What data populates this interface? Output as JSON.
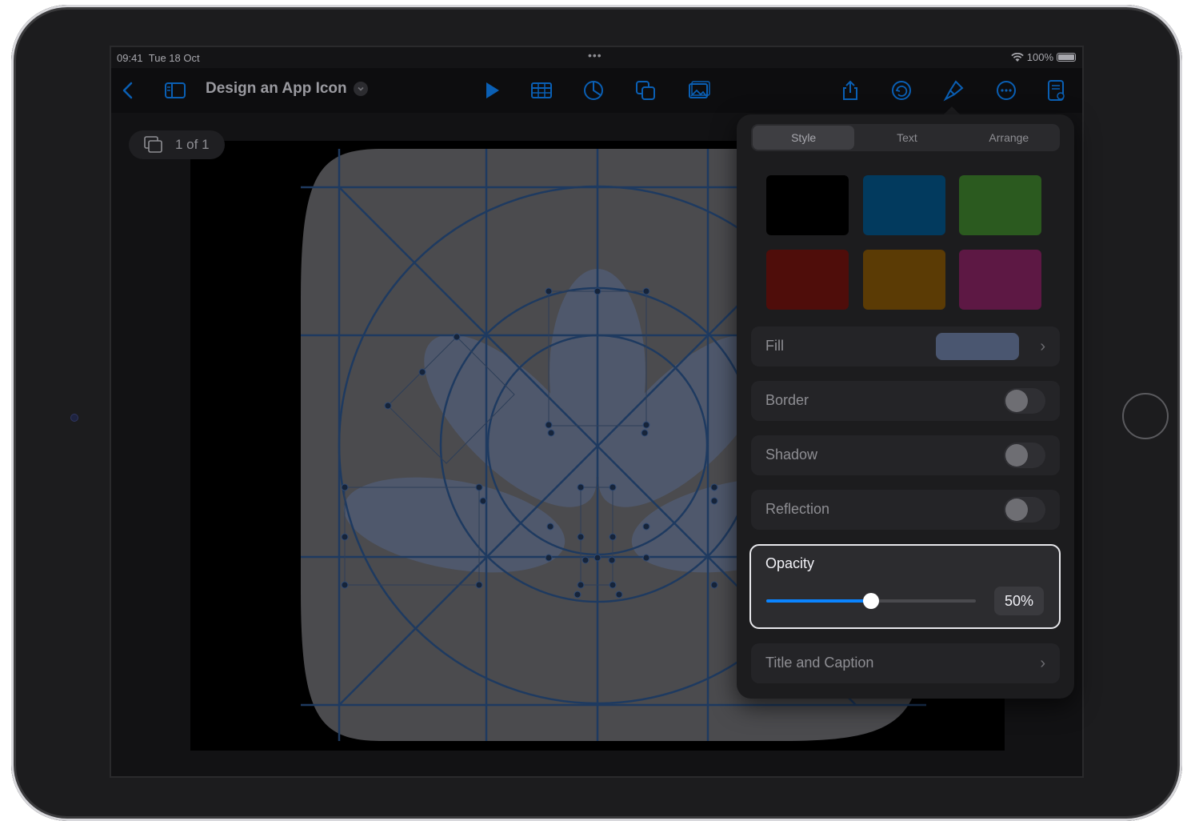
{
  "status_bar": {
    "time": "09:41",
    "date": "Tue 18 Oct",
    "dots": "•••",
    "battery": "100%"
  },
  "toolbar": {
    "title": "Design an App Icon",
    "icons": [
      "back-chevron-icon",
      "sidebar-icon",
      "play-icon",
      "table-icon",
      "chart-icon",
      "shapes-icon",
      "media-icon",
      "share-icon",
      "undo-icon",
      "format-brush-icon",
      "more-icon",
      "document-icon"
    ]
  },
  "canvas": {
    "page_indicator": "1 of 1"
  },
  "format_panel": {
    "tabs": [
      {
        "label": "Style",
        "active": true
      },
      {
        "label": "Text",
        "active": false
      },
      {
        "label": "Arrange",
        "active": false
      }
    ],
    "swatches": [
      "#000000",
      "#023a5e",
      "#2b5a1f",
      "#4f0d0a",
      "#5b3b05",
      "#5d1844"
    ],
    "fill_label": "Fill",
    "fill_color": "#4a5670",
    "border_label": "Border",
    "shadow_label": "Shadow",
    "reflection_label": "Reflection",
    "opacity_label": "Opacity",
    "opacity_value": "50%",
    "opacity_fraction": 0.5,
    "title_caption_label": "Title and Caption"
  }
}
